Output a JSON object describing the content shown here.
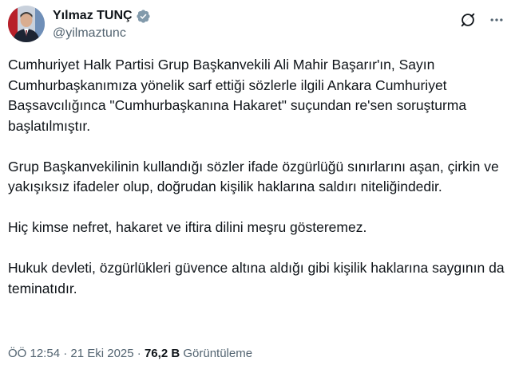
{
  "author": {
    "display_name": "Yılmaz TUNÇ",
    "handle": "@yilmaztunc",
    "verified_badge_color": "#829aab"
  },
  "actions": {
    "grok_icon": "grok-icon",
    "more_icon": "more-horizontal-icon"
  },
  "tweet": {
    "paragraphs": [
      "Cumhuriyet Halk Partisi Grup Başkanvekili Ali Mahir Başarır'ın, Sayın Cumhurbaşkanımıza yönelik sarf ettiği sözlerle ilgili Ankara Cumhuriyet Başsavcılığınca \"Cumhurbaşkanına Hakaret\" suçundan re'sen soruşturma başlatılmıştır.",
      "Grup Başkanvekilinin kullandığı sözler ifade özgürlüğü sınırlarını aşan, çirkin ve yakışıksız ifadeler olup, doğrudan kişilik haklarına saldırı niteliğindedir.",
      "Hiç kimse nefret, hakaret ve iftira dilini meşru gösteremez.",
      "Hukuk devleti, özgürlükleri güvence altına aldığı gibi kişilik haklarına saygının da teminatıdır."
    ]
  },
  "meta": {
    "time": "ÖÖ 12:54",
    "separator": "·",
    "date": "21 Eki 2025",
    "views_count": "76,2 B",
    "views_label": "Görüntüleme"
  },
  "colors": {
    "text_primary": "#0f1419",
    "text_secondary": "#536471"
  }
}
